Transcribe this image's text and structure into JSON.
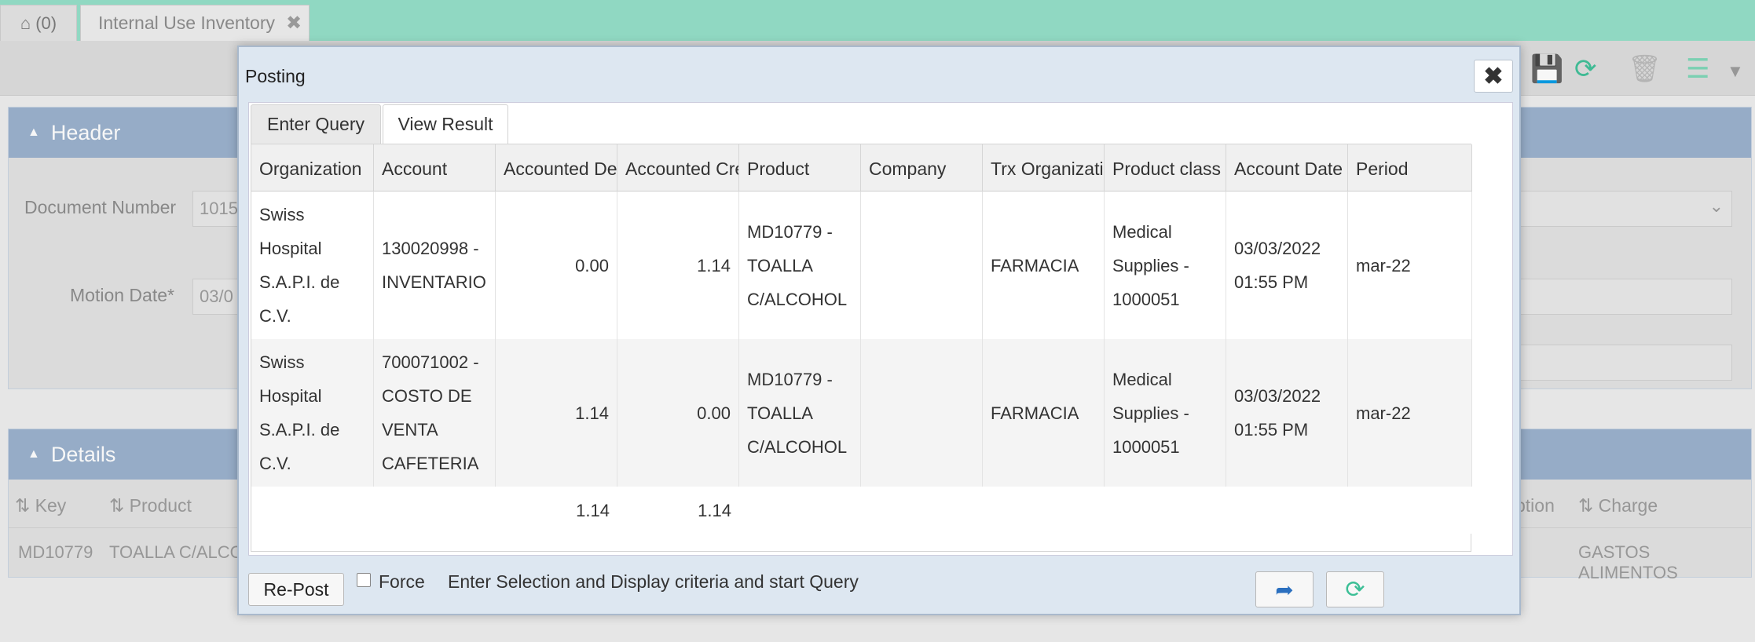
{
  "tabs": {
    "home_count": "(0)",
    "document_tab": "Internal Use Inventory"
  },
  "header_panel": {
    "title": "Header",
    "document_number_label": "Document Number",
    "document_number_value": "1015",
    "motion_date_label": "Motion Date*",
    "motion_date_value": "03/0"
  },
  "details_panel": {
    "title": "Details",
    "columns": [
      "Key",
      "Product",
      "ption",
      "Charge"
    ],
    "row": {
      "key": "MD10779",
      "product": "TOALLA C/ALCO",
      "charge": "GASTOS ALIMENTOS"
    }
  },
  "dialog": {
    "title": "Posting",
    "tabs": [
      "Enter Query",
      "View Result"
    ],
    "columns": [
      "Organization",
      "Account",
      "Accounted Del",
      "Accounted Cre",
      "Product",
      "Company",
      "Trx Organizatio",
      "Product class",
      "Account Date",
      "Period"
    ],
    "rows": [
      {
        "organization": [
          "Swiss",
          "Hospital",
          "S.A.P.I. de",
          "C.V."
        ],
        "account": [
          "130020998 -",
          "INVENTARIO"
        ],
        "debit": "0.00",
        "credit": "1.14",
        "product": [
          "MD10779 -",
          "TOALLA",
          "C/ALCOHOL"
        ],
        "company": "",
        "trx_org": "FARMACIA",
        "product_class": [
          "Medical",
          "Supplies -",
          "1000051"
        ],
        "account_date": [
          "03/03/2022",
          "01:55 PM"
        ],
        "period": "mar-22"
      },
      {
        "organization": [
          "Swiss",
          "Hospital",
          "S.A.P.I. de",
          "C.V."
        ],
        "account": [
          "700071002 -",
          "COSTO DE",
          "VENTA",
          "CAFETERIA"
        ],
        "debit": "1.14",
        "credit": "0.00",
        "product": [
          "MD10779 -",
          "TOALLA",
          "C/ALCOHOL"
        ],
        "company": "",
        "trx_org": "FARMACIA",
        "product_class": [
          "Medical",
          "Supplies -",
          "1000051"
        ],
        "account_date": [
          "03/03/2022",
          "01:55 PM"
        ],
        "period": "mar-22"
      }
    ],
    "totals": {
      "debit": "1.14",
      "credit": "1.14"
    },
    "footer": {
      "repost_label": "Re-Post",
      "force_label": "Force",
      "force_checked": false,
      "status_text": "Enter Selection and Display criteria and start Query"
    }
  },
  "colors": {
    "topbar": "#90d8c2",
    "panel_header": "#98b0cc",
    "dialog_bg": "#dde7f1",
    "refresh_icon": "#3cbf96",
    "export_icon": "#2a6fbf"
  },
  "icons": [
    "home-icon",
    "close-icon",
    "save-icon",
    "refresh-icon",
    "delete-icon",
    "list-icon",
    "chevron-down-icon",
    "export-icon"
  ]
}
